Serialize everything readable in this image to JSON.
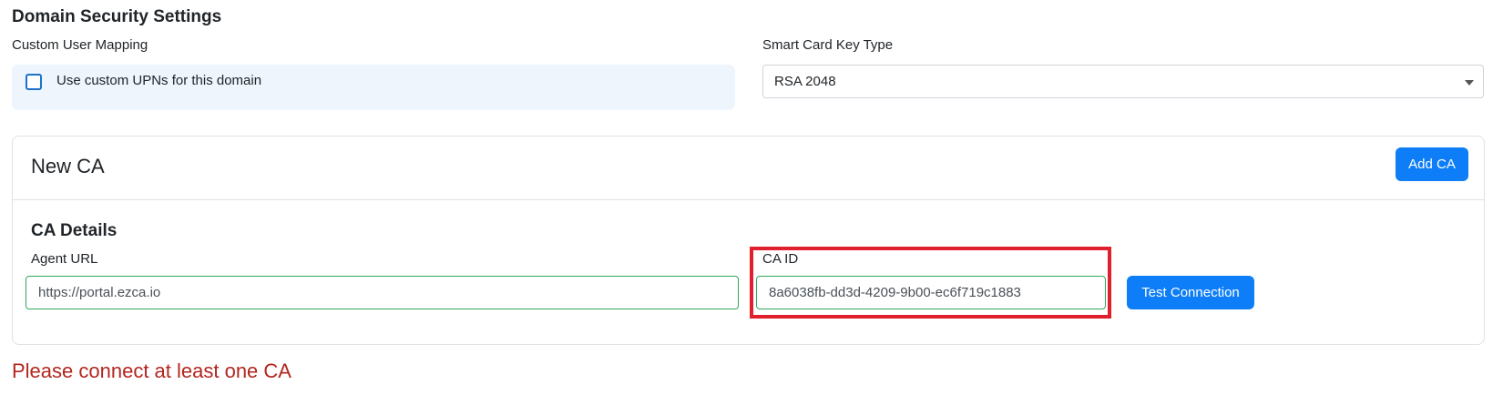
{
  "domain_security": {
    "title": "Domain Security Settings",
    "custom_mapping_label": "Custom User Mapping",
    "use_custom_upns_label": "Use custom UPNs for this domain",
    "use_custom_upns_checked": false,
    "key_type_label": "Smart Card Key Type",
    "key_type_value": "RSA 2048"
  },
  "new_ca": {
    "title": "New CA",
    "add_button": "Add CA",
    "details_title": "CA Details",
    "agent_url_label": "Agent URL",
    "agent_url_value": "https://portal.ezca.io",
    "ca_id_label": "CA ID",
    "ca_id_value": "8a6038fb-dd3d-4209-9b00-ec6f719c1883",
    "test_button": "Test Connection"
  },
  "error_message": "Please connect at least one CA",
  "colors": {
    "primary": "#0d7ef7",
    "valid_border": "#2fa85a",
    "highlight": "#e0202d",
    "error": "#b3261e"
  }
}
